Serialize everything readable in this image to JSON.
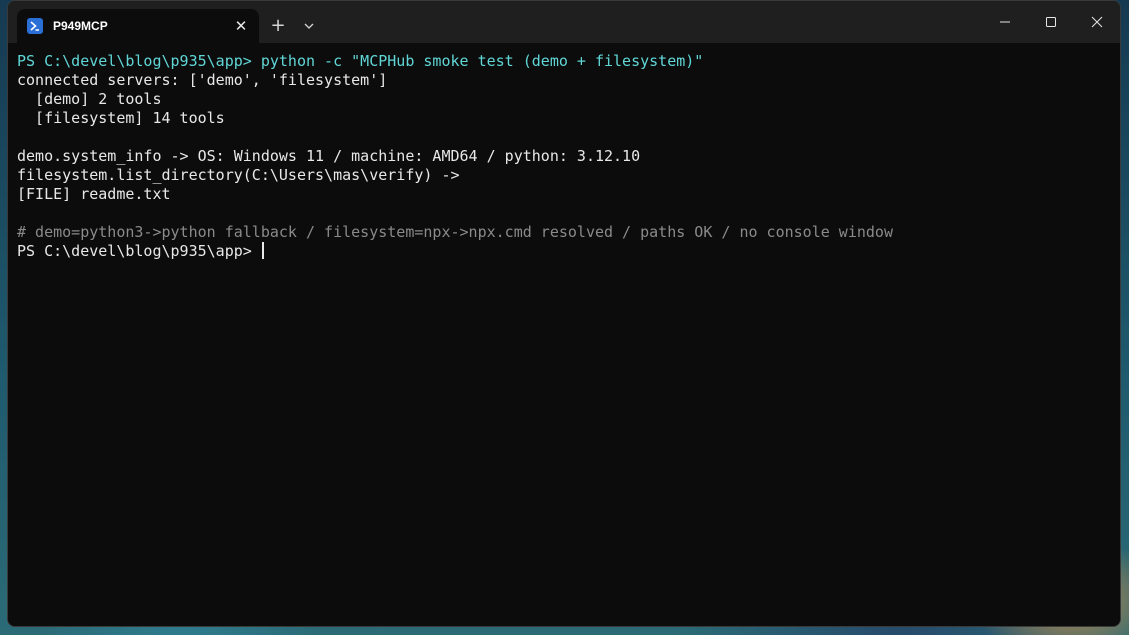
{
  "window": {
    "tab_title": "P949MCP",
    "tab_icon": "powershell-icon",
    "close_tab_glyph": "✕",
    "new_tab_glyph": "+",
    "accent": "#61d6d6"
  },
  "terminal": {
    "lines": {
      "cmd1": "PS C:\\devel\\blog\\p935\\app> python -c \"MCPHub smoke test (demo + filesystem)\"",
      "out1": "connected servers: ['demo', 'filesystem']",
      "out2": "  [demo] 2 tools",
      "out3": "  [filesystem] 14 tools",
      "out4": "demo.system_info -> OS: Windows 11 / machine: AMD64 / python: 3.12.10",
      "out5": "filesystem.list_directory(C:\\Users\\mas\\verify) ->",
      "out6": "[FILE] readme.txt",
      "comment": "# demo=python3->python fallback / filesystem=npx->npx.cmd resolved / paths OK / no console window",
      "prompt": "PS C:\\devel\\blog\\p935\\app> "
    }
  }
}
